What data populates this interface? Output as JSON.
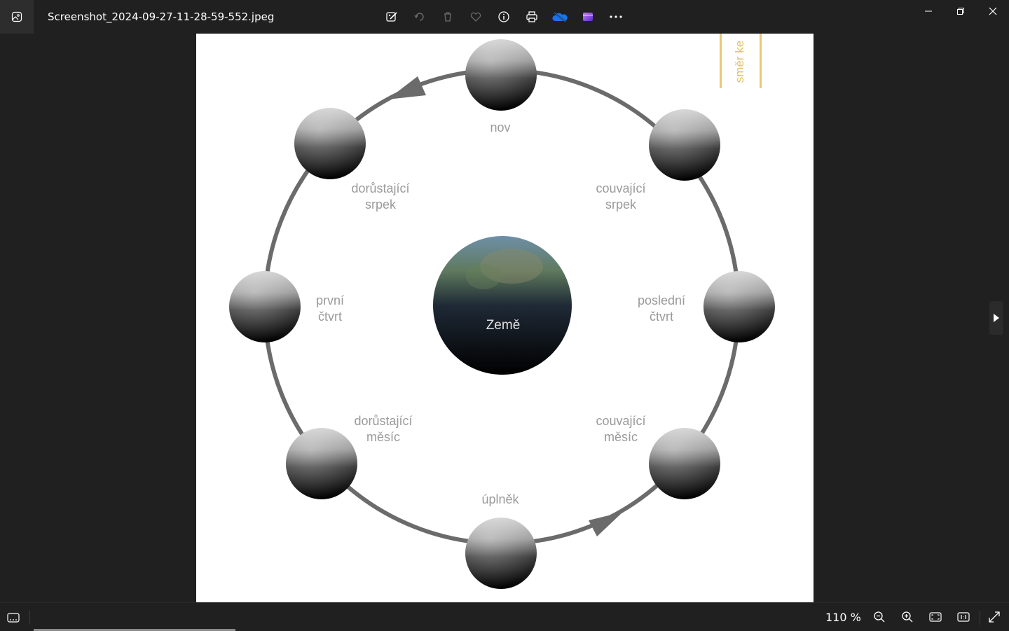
{
  "window": {
    "title": "Screenshot_2024-09-27-11-28-59-552.jpeg"
  },
  "toolbar": {
    "icons": [
      "edit-image-icon",
      "rotate-icon",
      "delete-icon",
      "favorite-icon",
      "info-icon",
      "print-icon",
      "onedrive-icon",
      "clipchamp-icon",
      "more-icon"
    ]
  },
  "statusbar": {
    "zoom": "110 %"
  },
  "diagram": {
    "direction_label": "směr ke",
    "earth_label": "Země",
    "phases": {
      "nov": [
        "nov"
      ],
      "dorustajici_srpek": [
        "dorůstající",
        "srpek"
      ],
      "couvajici_srpek": [
        "couvající",
        "srpek"
      ],
      "prvni_ctvrt": [
        "první",
        "čtvrt"
      ],
      "posledni_ctvrt": [
        "poslední",
        "čtvrt"
      ],
      "dorustajici_mesic": [
        "dorůstající",
        "měsíc"
      ],
      "couvajici_mesic": [
        "couvající",
        "měsíc"
      ],
      "uplnek": [
        "úplněk"
      ]
    }
  },
  "colors": {
    "background": "#202020",
    "orbit": "#6b6b6b",
    "direction_accent": "#e3bf6a",
    "label": "#9a9a9a"
  }
}
